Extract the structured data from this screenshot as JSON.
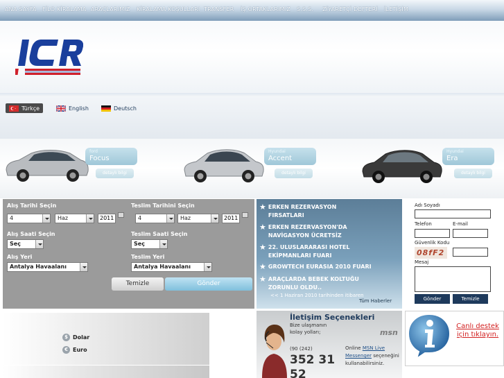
{
  "nav": {
    "items": [
      "ANA SAYFA",
      "FİLO KİRALAMA",
      "ARAÇLARIMIZ",
      "KİRALAMA KOŞULLARI",
      "TRANSFER",
      "İŞ ORTAKLARIMIZ",
      "S.S.S.",
      "ZİYARETÇİ DEFTERİ",
      "İLETİŞİM"
    ]
  },
  "logo": {
    "text": "ICR"
  },
  "languages": [
    {
      "label": "Türkçe",
      "active": true
    },
    {
      "label": "English",
      "active": false
    },
    {
      "label": "Deutsch",
      "active": false
    }
  ],
  "cars": [
    {
      "brand": "ford",
      "model": "Focus",
      "detail": "detaylı bilgi",
      "color": "#b9bcc0"
    },
    {
      "brand": "Hyundai",
      "model": "Accent",
      "detail": "detaylı bilgi",
      "color": "#c4c7cb"
    },
    {
      "brand": "Hyundai",
      "model": "Era",
      "detail": "detaylı bilgi",
      "color": "#3a3a3a"
    }
  ],
  "booking": {
    "pickup_date_label": "Alış Tarihi Seçin",
    "return_date_label": "Teslim Tarihini Seçin",
    "pickup_day": "4",
    "pickup_month": "Haz",
    "pickup_year": "2011",
    "return_day": "4",
    "return_month": "Haz",
    "return_year": "2011",
    "pickup_time_label": "Alış Saati Seçin",
    "return_time_label": "Teslim Saati Seçin",
    "pickup_time": "Seç",
    "return_time": "Seç",
    "pickup_place_label": "Alış Yeri",
    "return_place_label": "Teslim Yeri",
    "pickup_place": "Antalya Havaalanı",
    "return_place": "Antalya Havaalanı",
    "clear_label": "Temizle",
    "send_label": "Gönder"
  },
  "news": {
    "items": [
      {
        "line1": "ERKEN REZERVASYON",
        "line2": "FIRSATLARI"
      },
      {
        "line1": "ERKEN REZERVASYON'DA",
        "line2": "NAVİGASYON ÜCRETSİZ"
      },
      {
        "line1": "22. ULUSLARARASI HOTEL",
        "line2": "EKİPMANLARI FUARI"
      },
      {
        "line1": "GROWTECH EURASIA 2010 FUARI",
        "line2": ""
      },
      {
        "line1": "ARAÇLARDA BEBEK KOLTUĞU",
        "line2": "ZORUNLU OLDU.."
      }
    ],
    "sub": "<< 1 Haziran 2010 tarihinden itibaren",
    "all_label": "Tüm Haberler"
  },
  "contact_form": {
    "name_label": "Adı Soyadı",
    "phone_label": "Telefon",
    "email_label": "E-mail",
    "captcha_label": "Güvenlik Kodu",
    "captcha_code": "08fF2",
    "message_label": "Mesaj",
    "send_label": "Gönder",
    "clear_label": "Temizle"
  },
  "currency": {
    "items": [
      {
        "icon": "$",
        "label": "Dolar"
      },
      {
        "icon": "€",
        "label": "Euro"
      }
    ]
  },
  "contact": {
    "title": "İletişim Seçenekleri",
    "sub1": "Bize ulaşmanın",
    "sub2": "kolay yolları;",
    "phone_code": "(90 (242)",
    "phone_part1": "352 31",
    "phone_part2": "52",
    "msn_logo": "msn",
    "msn_prefix": "Online ",
    "msn_link": "MSN Live Messenger",
    "msn_suffix": " seçeneğini kullanabilirsiniz."
  },
  "support": {
    "text": "Canlı destek için tıklayın."
  }
}
